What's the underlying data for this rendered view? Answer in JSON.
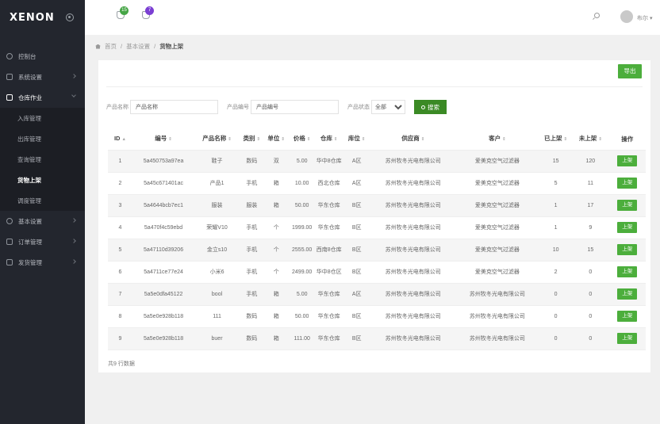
{
  "brand": {
    "logo": "XENON"
  },
  "sidebar": {
    "items": [
      {
        "label": "控制台",
        "icon": "dashboard-icon"
      },
      {
        "label": "系统设置",
        "icon": "monitor-icon"
      },
      {
        "label": "仓库作业",
        "icon": "box-icon"
      },
      {
        "label": "基本设置",
        "icon": "gear-icon"
      },
      {
        "label": "订单管理",
        "icon": "order-icon"
      },
      {
        "label": "发货管理",
        "icon": "truck-icon"
      }
    ],
    "sub_items": [
      "入库管理",
      "出库管理",
      "查询管理",
      "货物上架",
      "调度管理"
    ]
  },
  "header": {
    "badge_messages": "15",
    "badge_notifications": "7",
    "user_name": "布尔"
  },
  "breadcrumb": {
    "home": "首页",
    "sep": "/",
    "level1": "基本设置",
    "current": "货物上架"
  },
  "toolbar": {
    "export_label": "导出"
  },
  "filters": {
    "product_name_label": "产品名称",
    "product_name_placeholder": "产品名称",
    "product_no_label": "产品编号",
    "product_no_placeholder": "产品编号",
    "status_label": "产品状态",
    "status_value": "全部",
    "search_label": "搜索"
  },
  "table": {
    "headers": [
      "ID",
      "编号",
      "产品名称",
      "类别",
      "单位",
      "价格",
      "仓库",
      "库位",
      "供应商",
      "客户",
      "已上架",
      "未上架",
      "操作"
    ],
    "action_label": "上架",
    "rows": [
      [
        "1",
        "5a450753a97ea",
        "鞋子",
        "数码",
        "双",
        "5.00",
        "华中8仓库",
        "A区",
        "苏州牧冬光电有限公司",
        "爱美克空气过滤器",
        "15",
        "120"
      ],
      [
        "2",
        "5a45c671401ac",
        "产品1",
        "手机",
        "箱",
        "10.00",
        "西北仓库",
        "A区",
        "苏州牧冬光电有限公司",
        "爱美克空气过滤器",
        "5",
        "11"
      ],
      [
        "3",
        "5a4644bcb7ec1",
        "服装",
        "服装",
        "箱",
        "50.00",
        "华东仓库",
        "B区",
        "苏州牧冬光电有限公司",
        "爱美克空气过滤器",
        "1",
        "17"
      ],
      [
        "4",
        "5a470f4c59ebd",
        "荣耀V10",
        "手机",
        "个",
        "1999.00",
        "华东仓库",
        "B区",
        "苏州牧冬光电有限公司",
        "爱美克空气过滤器",
        "1",
        "9"
      ],
      [
        "5",
        "5a47110d39206",
        "金立s10",
        "手机",
        "个",
        "2555.00",
        "西南8仓库",
        "B区",
        "苏州牧冬光电有限公司",
        "爱美克空气过滤器",
        "10",
        "15"
      ],
      [
        "6",
        "5a4711ce77e24",
        "小米6",
        "手机",
        "个",
        "2499.00",
        "华中8仓区",
        "B区",
        "苏州牧冬光电有限公司",
        "爱美克空气过滤器",
        "2",
        "0"
      ],
      [
        "7",
        "5a5e0dfa45122",
        "bool",
        "手机",
        "箱",
        "5.00",
        "华东仓库",
        "A区",
        "苏州牧冬光电有限公司",
        "苏州牧冬光电有限公司",
        "0",
        "0"
      ],
      [
        "8",
        "5a5e0e928b118",
        "111",
        "数码",
        "箱",
        "50.00",
        "华东仓库",
        "B区",
        "苏州牧冬光电有限公司",
        "苏州牧冬光电有限公司",
        "0",
        "0"
      ],
      [
        "9",
        "5a5e0e928b118",
        "buer",
        "数码",
        "箱",
        "111.00",
        "华东仓库",
        "B区",
        "苏州牧冬光电有限公司",
        "苏州牧冬光电有限公司",
        "0",
        "0"
      ]
    ]
  },
  "footer": {
    "total_text": "共9 行数据"
  }
}
